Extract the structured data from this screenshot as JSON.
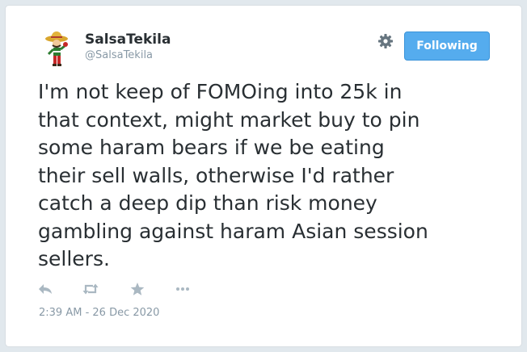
{
  "user": {
    "name": "SalsaTekila",
    "handle": "@SalsaTekila",
    "avatar_icon": "mascot-avatar"
  },
  "header": {
    "settings_icon": "gear-icon",
    "follow_label": "Following"
  },
  "tweet": {
    "text": "I'm not keep of FOMOing into 25k in\nthat context, might market buy to pin\nsome haram bears if we be eating\ntheir sell walls, otherwise I'd rather\ncatch a deep dip than risk money\ngambling against haram Asian session\nsellers.",
    "timestamp": "2:39 AM - 26 Dec 2020"
  },
  "actions": [
    "reply-icon",
    "retweet-icon",
    "favorite-icon",
    "more-icon"
  ],
  "colors": {
    "accent": "#55acee",
    "text": "#292f33",
    "muted": "#8899a6",
    "icon": "#aab8c2"
  }
}
